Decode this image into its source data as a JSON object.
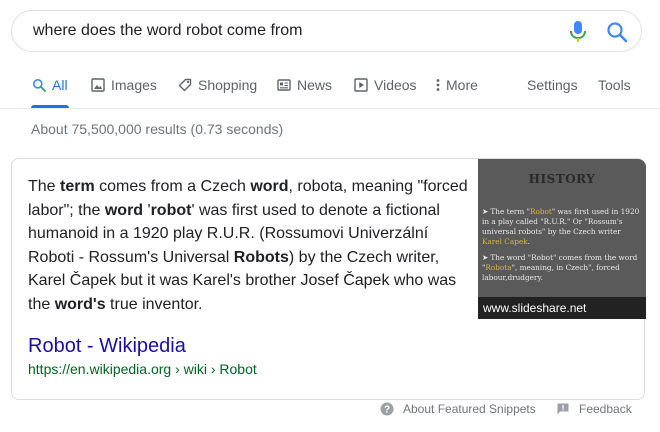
{
  "search": {
    "query": "where does the word robot come from"
  },
  "tabs": {
    "all": "All",
    "images": "Images",
    "shopping": "Shopping",
    "news": "News",
    "videos": "Videos",
    "more": "More",
    "settings": "Settings",
    "tools": "Tools"
  },
  "result_stats": "About 75,500,000 results (0.73 seconds)",
  "featured_snippet": {
    "parts": [
      {
        "text": "The ",
        "bold": false
      },
      {
        "text": "term",
        "bold": true
      },
      {
        "text": " comes from a Czech ",
        "bold": false
      },
      {
        "text": "word",
        "bold": true
      },
      {
        "text": ", robota, meaning \"forced labor\"; the ",
        "bold": false
      },
      {
        "text": "word",
        "bold": true
      },
      {
        "text": " '",
        "bold": false
      },
      {
        "text": "robot",
        "bold": true
      },
      {
        "text": "' was first used to denote a fictional humanoid in a 1920 play R.U.R. (Rossumovi Univerzální Roboti - Rossum's Universal ",
        "bold": false
      },
      {
        "text": "Robots",
        "bold": true
      },
      {
        "text": ") by the Czech writer, Karel Čapek but it was Karel's brother Josef Čapek who was the ",
        "bold": false
      },
      {
        "text": "word's",
        "bold": true
      },
      {
        "text": " true inventor.",
        "bold": false
      }
    ],
    "image": {
      "heading": "HISTORY",
      "caption": "www.slideshare.net"
    },
    "source_title": "Robot - Wikipedia",
    "source_cite": "https://en.wikipedia.org › wiki › Robot"
  },
  "footer": {
    "about": "About Featured Snippets",
    "feedback": "Feedback"
  },
  "colors": {
    "accent": "#1a73e8",
    "link": "#1a0dab",
    "cite": "#006621",
    "muted": "#70757a"
  }
}
